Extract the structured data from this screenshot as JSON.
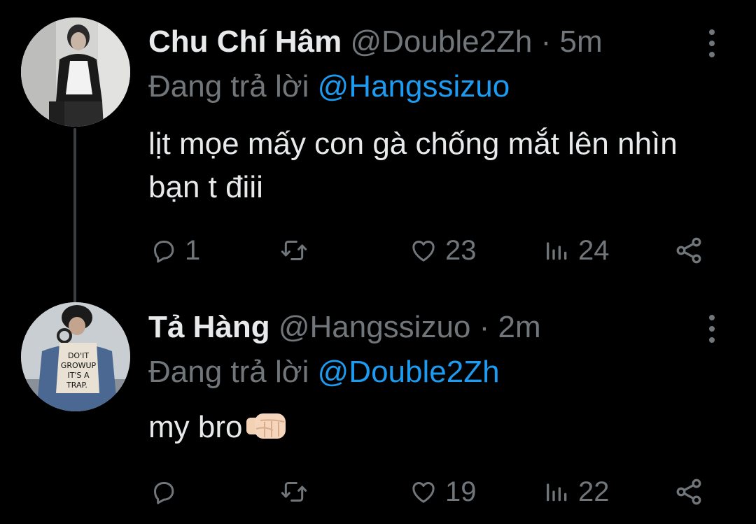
{
  "tweets": [
    {
      "name": "Chu Chí Hâm",
      "handle": "@Double2Zh",
      "separator": "·",
      "time": "5m",
      "reply_prefix": "Đang trả lời",
      "reply_to": "@Hangssizuo",
      "text": "lịt mọe mấy con gà chống mắt lên nhìn bạn t điii",
      "reply_count": "1",
      "retweet_count": "",
      "like_count": "23",
      "view_count": "24"
    },
    {
      "name": "Tả Hàng",
      "handle": "@Hangssizuo",
      "separator": "·",
      "time": "2m",
      "reply_prefix": "Đang trả lời",
      "reply_to": "@Double2Zh",
      "text": "my bro",
      "emoji": "left-facing-fist",
      "reply_count": "",
      "retweet_count": "",
      "like_count": "19",
      "view_count": "22"
    }
  ],
  "colors": {
    "background": "#000000",
    "primary_text": "#e7e9ea",
    "secondary_text": "#71767b",
    "link": "#1d9bf0",
    "thread_line": "#3a3d41"
  },
  "icons": [
    "more-icon",
    "reply-icon",
    "retweet-icon",
    "like-icon",
    "views-icon",
    "share-icon"
  ]
}
